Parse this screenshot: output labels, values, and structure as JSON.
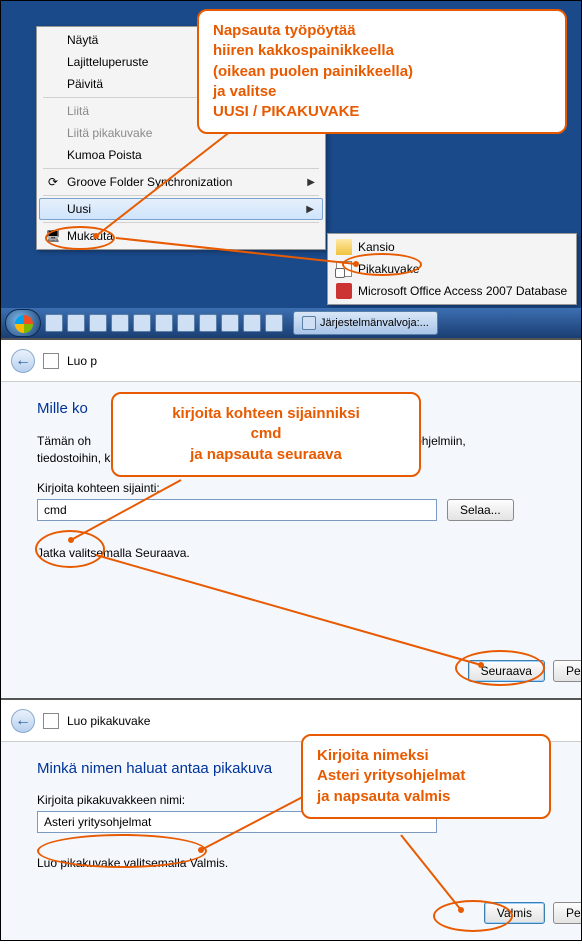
{
  "callouts": {
    "c1_l1": "Napsauta työpöytää",
    "c1_l2": "hiiren kakkospainikkeella",
    "c1_l3": "(oikean puolen painikkeella)",
    "c1_l4": "ja valitse",
    "c1_l5": "UUSI / PIKAKUVAKE",
    "c2_l1": "kirjoita kohteen sijainniksi",
    "c2_l2": "cmd",
    "c2_l3": "ja napsauta seuraava",
    "c3_l1": "Kirjoita nimeksi",
    "c3_l2": "Asteri yritysohjelmat",
    "c3_l3": "ja napsauta valmis"
  },
  "context_menu": {
    "view": "Näytä",
    "sort": "Lajitteluperuste",
    "refresh": "Päivitä",
    "paste": "Liitä",
    "paste_shortcut": "Liitä pikakuvake",
    "undo": "Kumoa Poista",
    "groove": "Groove Folder Synchronization",
    "new": "Uusi",
    "personalize": "Mukauta"
  },
  "submenu": {
    "folder": "Kansio",
    "shortcut": "Pikakuvake",
    "access": "Microsoft Office Access 2007 Database"
  },
  "taskbar": {
    "task": "Järjestelmänvalvoja:..."
  },
  "wizard1": {
    "window_title": "Luo p",
    "heading": "Mille ko",
    "desc_a": "Tämän oh",
    "desc_b": "oleviin ohjelmiin,",
    "desc2": "tiedostoihin, kansioihin, tietokoneisiin tai Internet-osoitteisiin.",
    "label": "Kirjoita kohteen sijainti:",
    "value": "cmd",
    "browse": "Selaa...",
    "continue": "Jatka valitsemalla Seuraava.",
    "next": "Seuraava",
    "cancel": "Peruu"
  },
  "wizard2": {
    "window_title": "Luo pikakuvake",
    "heading": "Minkä nimen haluat antaa pikakuva",
    "label": "Kirjoita pikakuvakkeen nimi:",
    "value": "Asteri yritysohjelmat",
    "continue": "Luo pikakuvake valitsemalla Valmis.",
    "finish": "Valmis",
    "cancel": "Peruu"
  }
}
